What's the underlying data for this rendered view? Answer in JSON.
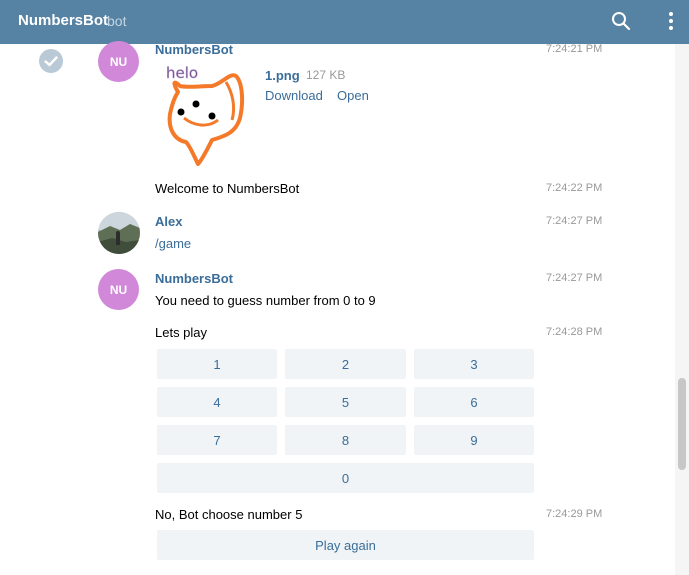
{
  "header": {
    "title": "NumbersBot",
    "subtitle": "bot",
    "search_icon": "search-icon",
    "menu_icon": "more-vertical-icon",
    "bg_color": "#5682a3"
  },
  "messages": {
    "m1": {
      "avatar_initials": "NU",
      "author": "NumbersBot",
      "time": "7:24:21 PM",
      "sticker_text": "helo",
      "file_name": "1.png",
      "file_size": "127 KB",
      "download_label": "Download",
      "open_label": "Open"
    },
    "m2": {
      "text": "Welcome to NumbersBot",
      "time": "7:24:22 PM"
    },
    "m3": {
      "author": "Alex",
      "text": "/game",
      "time": "7:24:27 PM"
    },
    "m4": {
      "avatar_initials": "NU",
      "author": "NumbersBot",
      "text": "You need to guess number from 0 to 9",
      "time": "7:24:27 PM"
    },
    "m5": {
      "text": "Lets play",
      "time": "7:24:28 PM"
    },
    "keyboard": [
      "1",
      "2",
      "3",
      "4",
      "5",
      "6",
      "7",
      "8",
      "9",
      "0"
    ],
    "m6": {
      "text": "No, Bot choose number 5",
      "time": "7:24:29 PM",
      "button": "Play again"
    }
  }
}
